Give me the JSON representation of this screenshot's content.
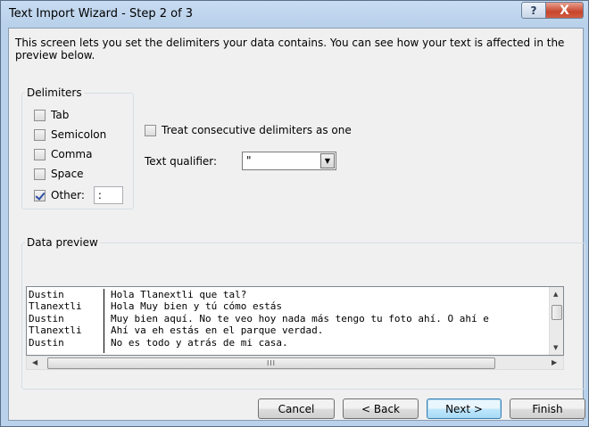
{
  "window": {
    "title": "Text Import Wizard - Step 2 of 3",
    "help_label": "?",
    "close_label": "X"
  },
  "description": "This screen lets you set the delimiters your data contains.  You can see how your text is affected in the preview below.",
  "delimiters": {
    "legend": "Delimiters",
    "items": [
      {
        "label": "Tab",
        "checked": false
      },
      {
        "label": "Semicolon",
        "checked": false
      },
      {
        "label": "Comma",
        "checked": false
      },
      {
        "label": "Space",
        "checked": false
      },
      {
        "label": "Other:",
        "checked": true
      }
    ],
    "other_value": ":"
  },
  "treat_consecutive": {
    "label": "Treat consecutive delimiters as one",
    "checked": false
  },
  "text_qualifier": {
    "label": "Text qualifier:",
    "value": "\""
  },
  "preview": {
    "legend": "Data preview",
    "rows": [
      [
        "Dustin",
        "Hola Tlanextli que tal?"
      ],
      [
        "Tlanextli",
        "Hola Muy bien y tú cómo estás"
      ],
      [
        "Dustin",
        "Muy bien aquí. No te veo hoy nada más tengo tu foto ahí. O ahí e"
      ],
      [
        "Tlanextli",
        "Ahí va eh estás en el parque verdad."
      ],
      [
        "Dustin",
        "No es todo y atrás de mi casa."
      ]
    ],
    "hscroll_grip": "III"
  },
  "buttons": {
    "cancel": "Cancel",
    "back": "< Back",
    "next": "Next >",
    "finish": "Finish"
  }
}
